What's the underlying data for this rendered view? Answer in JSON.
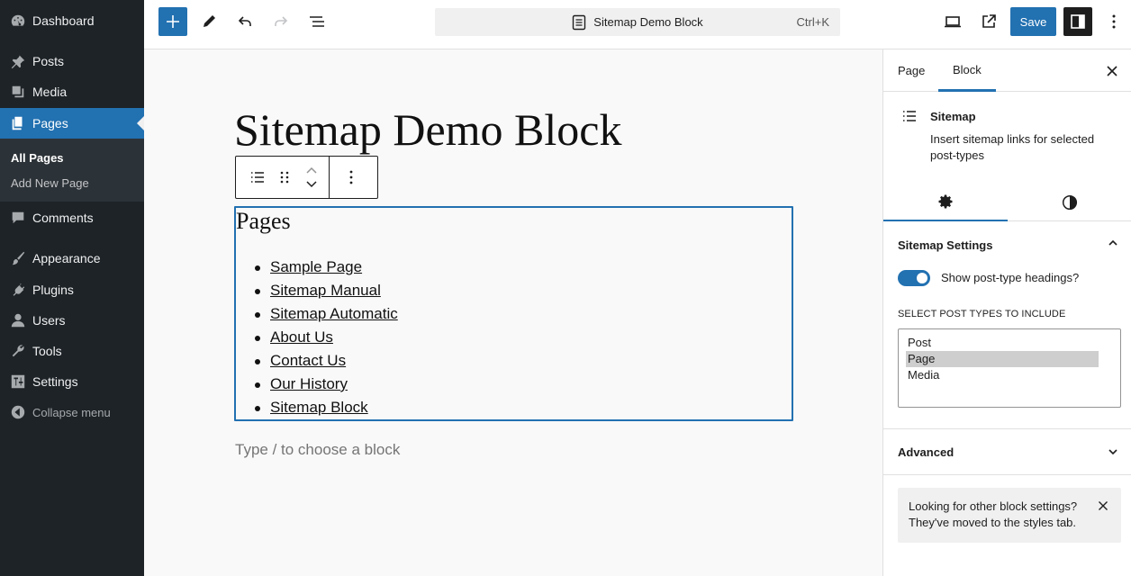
{
  "admin_menu": {
    "dashboard": "Dashboard",
    "posts": "Posts",
    "media": "Media",
    "pages": "Pages",
    "sub_all_pages": "All Pages",
    "sub_add_new": "Add New Page",
    "comments": "Comments",
    "appearance": "Appearance",
    "plugins": "Plugins",
    "users": "Users",
    "tools": "Tools",
    "settings": "Settings",
    "collapse": "Collapse menu"
  },
  "toolbar": {
    "document_title": "Sitemap Demo Block",
    "shortcut": "Ctrl+K",
    "save_label": "Save"
  },
  "editor": {
    "post_title": "Sitemap Demo Block",
    "block_heading": "Pages",
    "links": [
      "Sample Page",
      "Sitemap Manual",
      "Sitemap Automatic",
      "About Us",
      "Contact Us",
      "Our History",
      "Sitemap Block"
    ],
    "placeholder": "Type / to choose a block"
  },
  "sidebar": {
    "tab_page": "Page",
    "tab_block": "Block",
    "block_name": "Sitemap",
    "block_description": "Insert sitemap links for selected post-types",
    "settings_title": "Sitemap Settings",
    "toggle_label": "Show post-type headings?",
    "toggle_on": true,
    "select_label": "SELECT POST TYPES TO INCLUDE",
    "post_types": [
      "Post",
      "Page",
      "Media"
    ],
    "selected_post_type": "Page",
    "advanced_title": "Advanced",
    "notice_text": "Looking for other block settings? They've moved to the styles tab."
  },
  "colors": {
    "admin_bg": "#1d2327",
    "accent": "#2271b1"
  }
}
